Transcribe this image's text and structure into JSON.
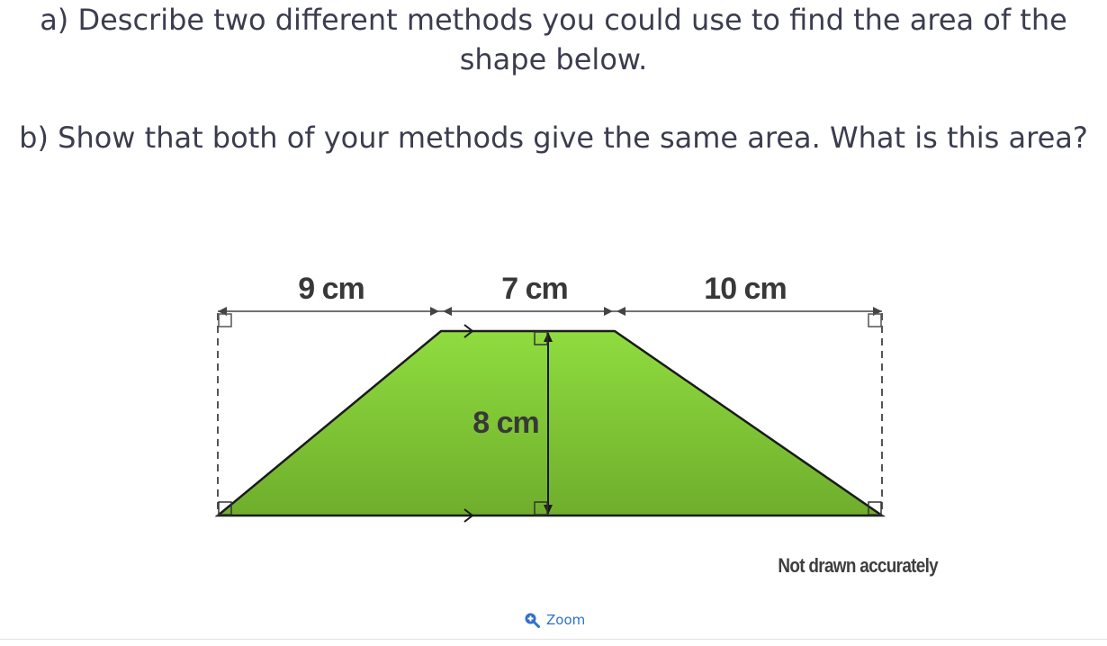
{
  "question": {
    "part_a": "a) Describe two different methods you could use to find the area of the shape below.",
    "part_b": "b) Show that both of your methods give the same area. What is this area?"
  },
  "diagram": {
    "shape": "trapezium",
    "fill_color": "#7cc23a",
    "labels": {
      "left_base_segment": "9 cm",
      "top_side": "7 cm",
      "right_base_segment": "10 cm",
      "height": "8 cm"
    }
  },
  "note": "Not drawn accurately",
  "zoom": {
    "label": "Zoom",
    "icon": "zoom-in-icon",
    "color": "#2f6fd0"
  }
}
